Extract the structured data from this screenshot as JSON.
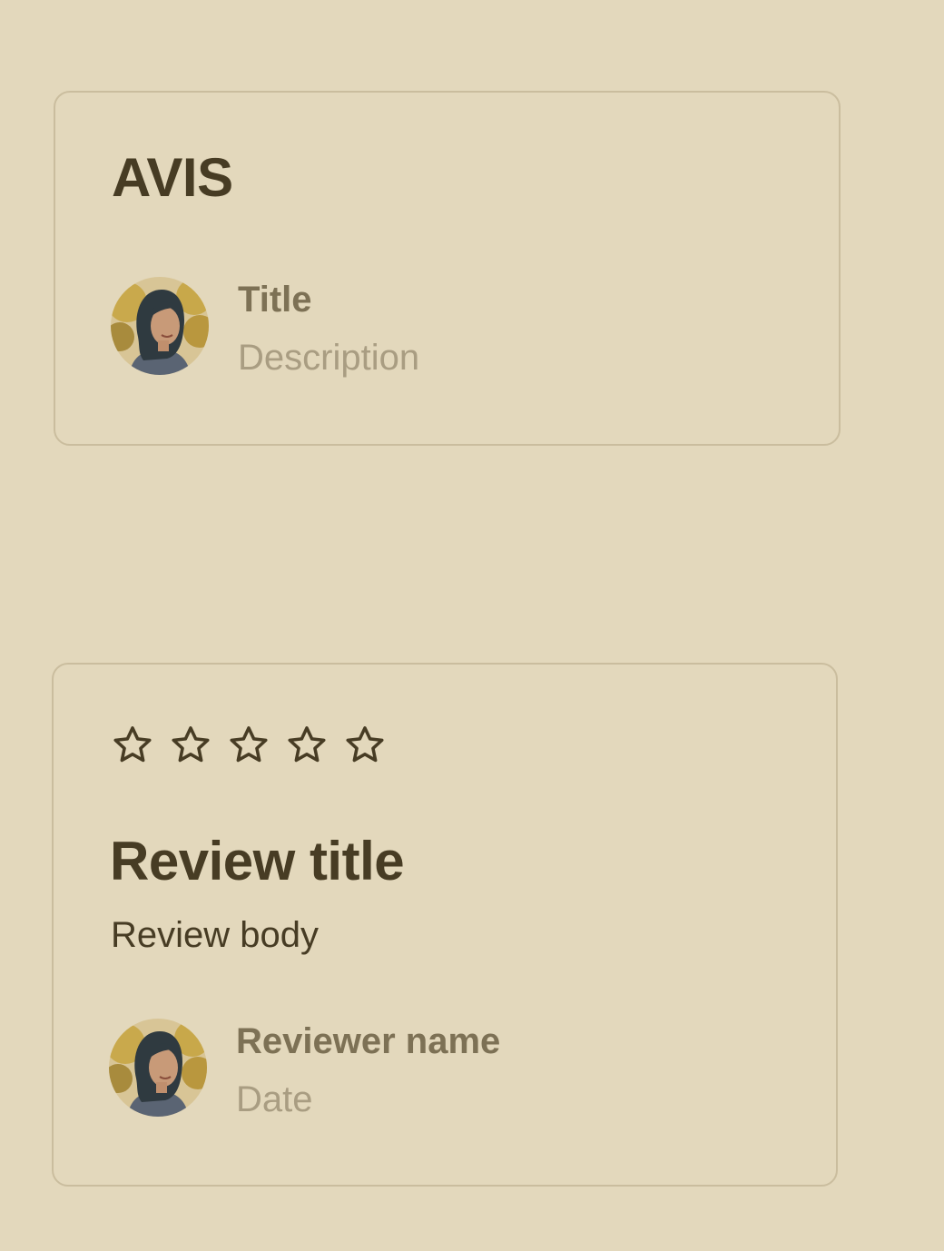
{
  "card_avis": {
    "heading": "AVIS",
    "title": "Title",
    "description": "Description"
  },
  "card_review": {
    "rating_filled": 0,
    "rating_max": 5,
    "stars": [
      "star-outline-icon",
      "star-outline-icon",
      "star-outline-icon",
      "star-outline-icon",
      "star-outline-icon"
    ],
    "review_title": "Review title",
    "review_body": "Review body",
    "reviewer_name": "Reviewer name",
    "date": "Date"
  },
  "colors": {
    "background": "#e3d8bc",
    "border": "#cabd9e",
    "heading": "#473c24",
    "primary_text": "#7d7155",
    "secondary_text": "#a99d82"
  }
}
